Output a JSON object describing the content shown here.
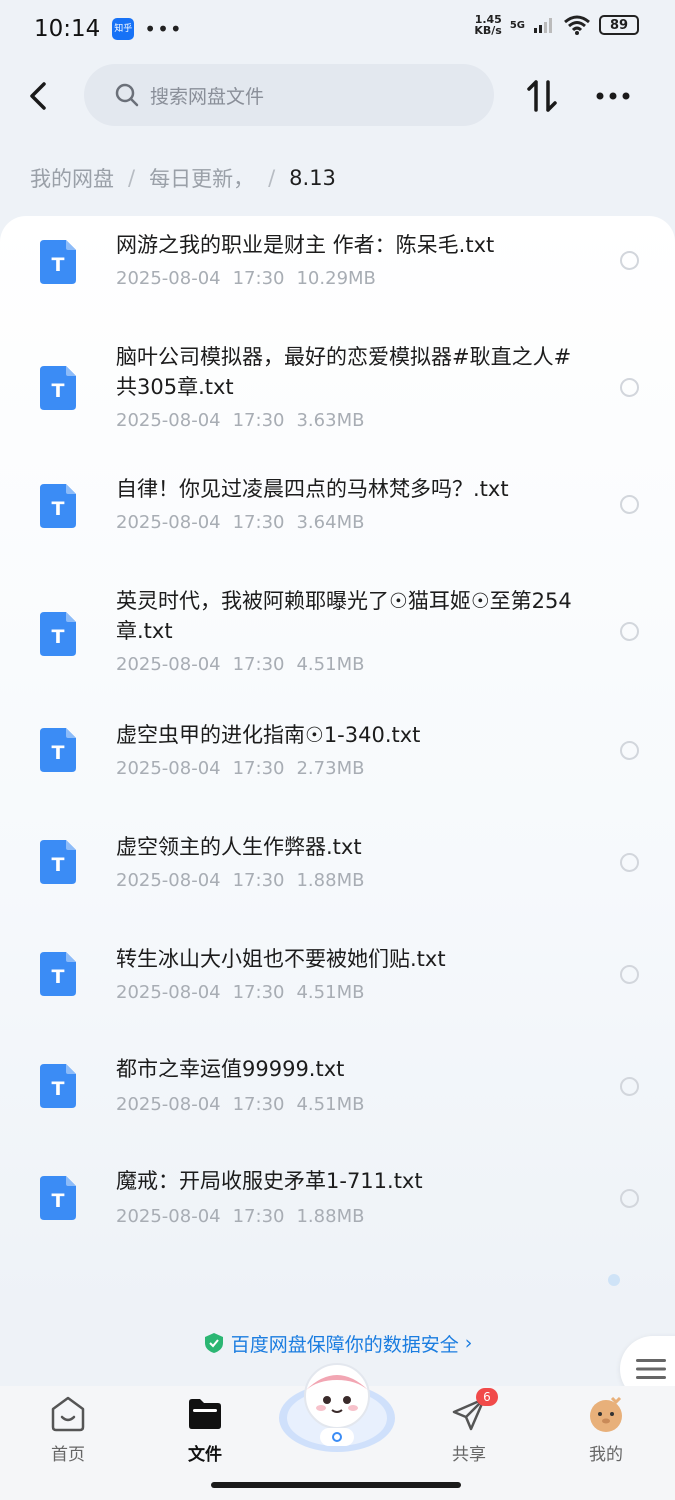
{
  "status_bar": {
    "time": "10:14",
    "app_badge": "知乎",
    "net_speed_top": "1.45",
    "net_speed_bottom": "KB/s",
    "network": "5G",
    "battery": "89"
  },
  "search": {
    "placeholder": "搜索网盘文件"
  },
  "breadcrumb": {
    "root": "我的网盘",
    "middle": "每日更新，",
    "current": "8.13"
  },
  "files": [
    {
      "name": "网游之我的职业是财主 作者：陈呆毛.txt",
      "date": "2025-08-04",
      "time": "17:30",
      "size": "10.29MB"
    },
    {
      "name": "脑叶公司模拟器，最好的恋爱模拟器#耿直之人#共305章.txt",
      "date": "2025-08-04",
      "time": "17:30",
      "size": "3.63MB"
    },
    {
      "name": "自律！你见过凌晨四点的马林梵多吗？.txt",
      "date": "2025-08-04",
      "time": "17:30",
      "size": "3.64MB"
    },
    {
      "name": "英灵时代，我被阿赖耶曝光了☉猫耳姬☉至第254章.txt",
      "date": "2025-08-04",
      "time": "17:30",
      "size": "4.51MB"
    },
    {
      "name": "虚空虫甲的进化指南☉1-340.txt",
      "date": "2025-08-04",
      "time": "17:30",
      "size": "2.73MB"
    },
    {
      "name": "虚空领主的人生作弊器.txt",
      "date": "2025-08-04",
      "time": "17:30",
      "size": "1.88MB"
    },
    {
      "name": "转生冰山大小姐也不要被她们贴.txt",
      "date": "2025-08-04",
      "time": "17:30",
      "size": "4.51MB"
    },
    {
      "name": "都市之幸运值99999.txt",
      "date": "2025-08-04",
      "time": "17:30",
      "size": "4.51MB"
    },
    {
      "name": "魔戒：开局收服史矛革1-711.txt",
      "date": "2025-08-04",
      "time": "17:30",
      "size": "1.88MB"
    }
  ],
  "file_icon_letter": "T",
  "security_banner": "百度网盘保障你的数据安全",
  "nav": {
    "home": "首页",
    "files": "文件",
    "share": "共享",
    "share_badge": "6",
    "mine": "我的"
  },
  "colors": {
    "accent": "#1b7de0",
    "file_icon": "#3b8cf5",
    "badge": "#f14a4a"
  }
}
